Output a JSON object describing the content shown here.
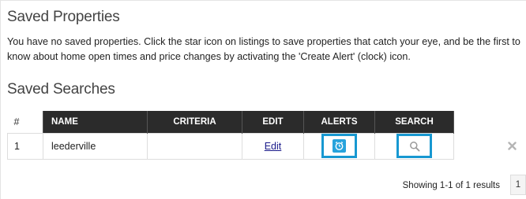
{
  "saved_properties": {
    "title": "Saved Properties",
    "message": "You have no saved properties. Click the star icon on listings to save properties that catch your eye, and be the first to know about home open times and price changes by activating the 'Create Alert' (clock) icon."
  },
  "saved_searches": {
    "title": "Saved Searches",
    "columns": {
      "num": "#",
      "name": "NAME",
      "criteria": "CRITERIA",
      "edit": "EDIT",
      "alerts": "ALERTS",
      "search": "SEARCH"
    },
    "rows": [
      {
        "num": "1",
        "name": "leederville",
        "criteria": "",
        "edit_label": "Edit",
        "alerts_icon": "alarm-clock-icon",
        "search_icon": "magnifier-icon",
        "delete_icon": "close-icon"
      }
    ],
    "pager": {
      "summary": "Showing 1-1 of 1 results",
      "current_page": "1"
    }
  },
  "colors": {
    "header_bg": "#2b2b2b",
    "accent": "#1798d1",
    "alarm_fill": "#27a3dc"
  }
}
